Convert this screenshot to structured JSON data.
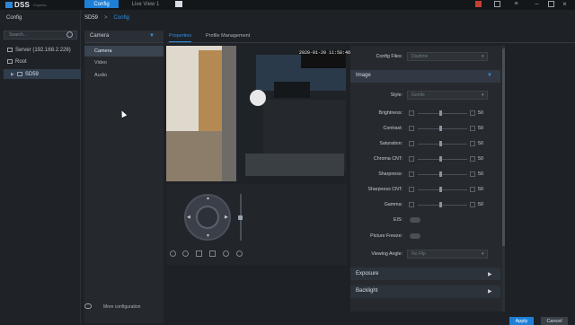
{
  "app": {
    "logo_text": "DSS",
    "logo_sub": "Express",
    "top_tabs": [
      {
        "label": "Config"
      },
      {
        "label": "Live View 1"
      }
    ]
  },
  "sidebar": {
    "title": "Config",
    "search_placeholder": "Search...",
    "tree": [
      {
        "label": "Server (192.168.2.228)"
      },
      {
        "label": "Root"
      },
      {
        "label": "SD59"
      }
    ]
  },
  "breadcrumb": [
    "SD59",
    "Config"
  ],
  "subsidebar": {
    "select": "Camera",
    "items": [
      {
        "label": "Camera"
      },
      {
        "label": "Video"
      },
      {
        "label": "Audio"
      }
    ],
    "footer": "More configuration"
  },
  "main_tabs": [
    {
      "label": "Properties"
    },
    {
      "label": "Profile Management"
    }
  ],
  "video": {
    "osd_timestamp": "2020-01-20 11:58:46"
  },
  "config": {
    "config_files_label": "Config Files:",
    "config_files_value": "Daytime",
    "image_section": "Image",
    "style_label": "Style:",
    "style_value": "Gentle",
    "sliders": [
      {
        "label": "Brightness:",
        "value": "50"
      },
      {
        "label": "Contrast:",
        "value": "50"
      },
      {
        "label": "Saturation:",
        "value": "50"
      },
      {
        "label": "Chroma CNT:",
        "value": "50"
      },
      {
        "label": "Sharpness:",
        "value": "50"
      },
      {
        "label": "Sharpness CNT:",
        "value": "50"
      },
      {
        "label": "Gamma:",
        "value": "50"
      }
    ],
    "eis_label": "EIS:",
    "picture_freeze_label": "Picture Freeze:",
    "viewing_angle_label": "Viewing Angle:",
    "viewing_angle_value": "No Flip",
    "sections": [
      {
        "label": "Exposure"
      },
      {
        "label": "Backlight"
      }
    ]
  },
  "buttons": {
    "apply": "Apply",
    "cancel": "Cancel"
  },
  "colors": {
    "accent": "#1d7fd6",
    "window_bg": "#1e2125"
  }
}
